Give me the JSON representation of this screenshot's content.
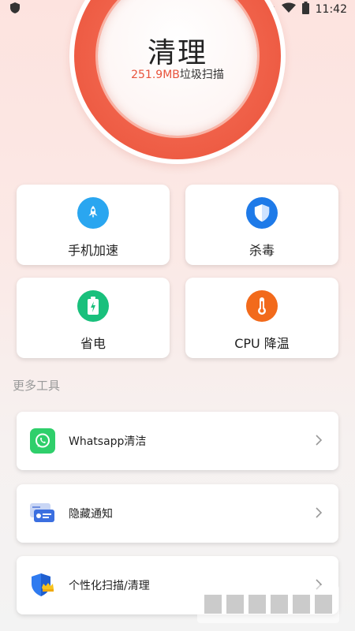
{
  "status_bar": {
    "time": "11:42"
  },
  "hero": {
    "title": "清理",
    "amount": "251.9MB",
    "suffix": "垃圾扫描"
  },
  "tiles": [
    {
      "label": "手机加速",
      "icon": "rocket-icon",
      "color": "#2aa6f0"
    },
    {
      "label": "杀毒",
      "icon": "shield-icon",
      "color": "#1e7ae8"
    },
    {
      "label": "省电",
      "icon": "battery-icon",
      "color": "#19c07c"
    },
    {
      "label": "CPU 降温",
      "icon": "thermometer-icon",
      "color": "#f26a1b"
    }
  ],
  "section": {
    "title": "更多工具"
  },
  "tools": [
    {
      "label": "Whatsapp清洁",
      "icon": "whatsapp-icon"
    },
    {
      "label": "隐藏通知",
      "icon": "notification-card-icon"
    },
    {
      "label": "个性化扫描/清理",
      "icon": "crown-shield-icon"
    }
  ]
}
